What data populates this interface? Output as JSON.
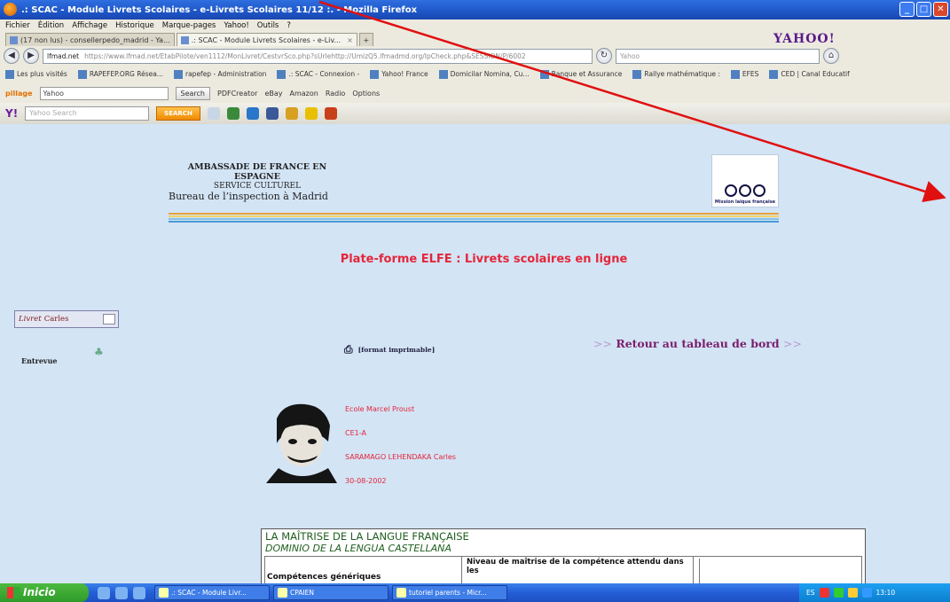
{
  "window": {
    "title": ".: SCAC - Module Livrets Scolaires - e-Livrets Scolaires 11/12 :. - Mozilla Firefox",
    "minimize": "_",
    "maximize": "□",
    "close": "✕"
  },
  "menu": [
    "Fichier",
    "Édition",
    "Affichage",
    "Historique",
    "Marque-pages",
    "Yahoo!",
    "Outils",
    "?"
  ],
  "yahoo_logo": "YAHOO!",
  "tabs": [
    {
      "label": "(17 non lus) - consellerpedo_madrid - Ya..."
    },
    {
      "label": ".: SCAC - Module Livrets Scolaires - e-Liv..."
    }
  ],
  "nav": {
    "back": "◀",
    "forward": "▶",
    "domain": "lfmad.net",
    "url": "https://www.lfmad.net/EtabPilote/ven1112/MonLivret/CestvrSco.php?sUrlehttp://UmizQ5.lfmadmd.org/IpCheck.php&SESSION/P/6002",
    "search_placeholder": "Yahoo"
  },
  "bookmarks": [
    "Les plus visités",
    "RAPEFEP.ORG Résea...",
    "rapefep - Administration",
    ".: SCAC - Connexion -",
    "Yahoo! France",
    "Domicilar Nomina, Cu...",
    "Banque et Assurance",
    "Rallye mathématique :",
    "EFES",
    "CED | Canal Educatif"
  ],
  "toolbar1": {
    "brand": "pillage",
    "search_value": "Yahoo",
    "search_btn": "Search",
    "items": [
      "PDFCreator",
      "eBay",
      "Amazon",
      "Radio",
      "Options"
    ]
  },
  "toolbar2": {
    "placeholder": "Yahoo Search",
    "search_btn": "SEARCH"
  },
  "page": {
    "header_l1": "AMBASSADE DE FRANCE EN ESPAGNE",
    "header_l2": "SERVICE CULTUREL",
    "header_l3": "Bureau de l’inspection à Madrid",
    "logo_caption": "Mission laïque française",
    "platform_title": "Plate-forme ELFE : Livrets scolaires en ligne",
    "sidebar_livret": "Livret",
    "sidebar_name": "Carles",
    "entrevue": "Entrevue",
    "print_label": "[format imprimable]",
    "retour_prefix": ">>",
    "retour_label": "Retour au tableau de bord",
    "retour_suffix": ">>",
    "student": {
      "school": "Ecole Marcel Proust",
      "class": "CE1-A",
      "name": "SARAMAGO LEHENDAKA Carles",
      "dob": "30-08-2002"
    },
    "table": {
      "title_fr": "LA MAÎTRISE DE LA LANGUE FRANÇAISE",
      "title_es": "DOMINIO DE LA LENGUA CASTELLANA",
      "col1": "Compétences génériques",
      "col2": "Niveau de maîtrise de la compétence attendu dans les"
    }
  },
  "taskbar": {
    "start": "Inicio",
    "tasks": [
      ".: SCAC - Module Livr...",
      "CPAIEN",
      "tutoriel parents - Micr..."
    ],
    "lang": "ES",
    "clock": "13:10"
  },
  "colors": {
    "accent_red": "#e5263a",
    "page_bg": "#d3e4f5",
    "retour_purple": "#7a1e6a",
    "table_green": "#1f5e1f"
  }
}
